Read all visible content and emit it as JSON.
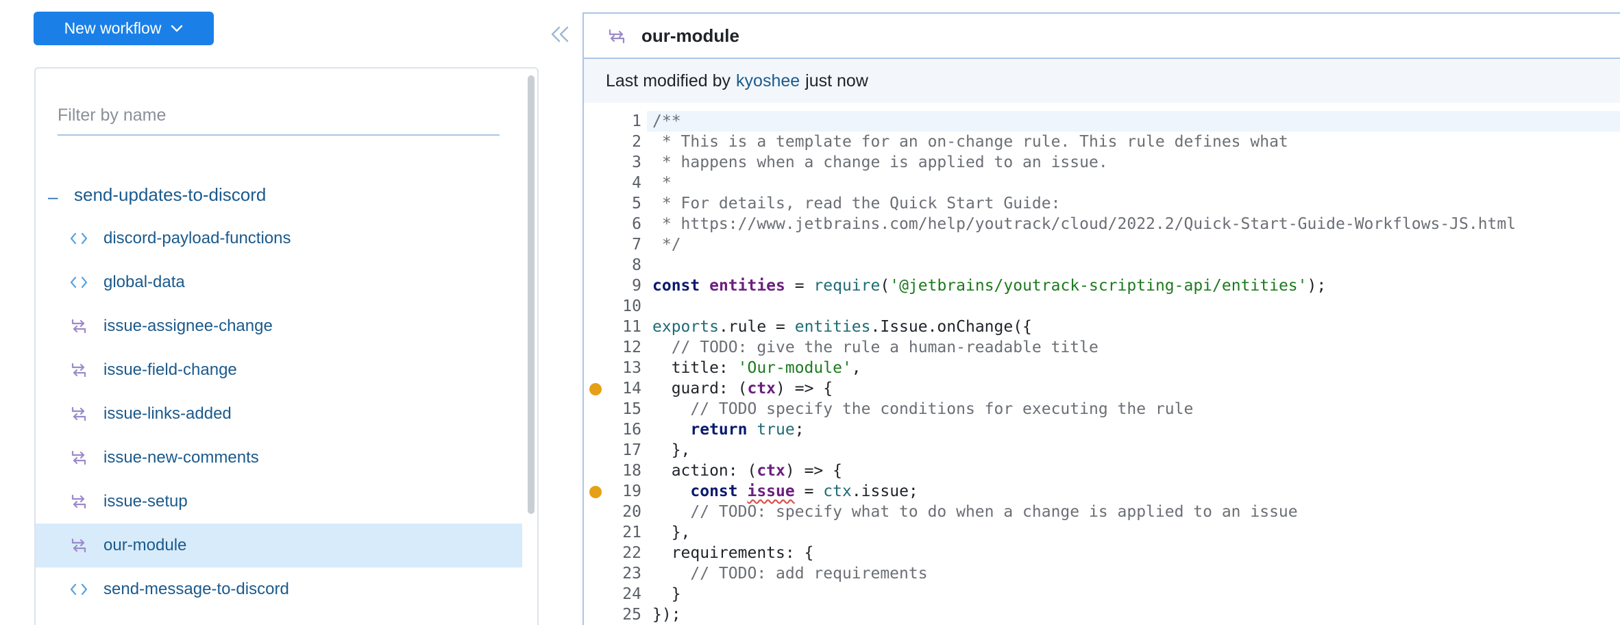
{
  "toolbar": {
    "new_workflow_label": "New workflow"
  },
  "sidebar": {
    "filter_placeholder": "Filter by name",
    "group": {
      "label": "send-updates-to-discord",
      "toggle": "–"
    },
    "items": [
      {
        "label": "discord-payload-functions",
        "icon": "code-icon"
      },
      {
        "label": "global-data",
        "icon": "code-icon"
      },
      {
        "label": "issue-assignee-change",
        "icon": "rule-arrows-icon"
      },
      {
        "label": "issue-field-change",
        "icon": "rule-arrows-icon"
      },
      {
        "label": "issue-links-added",
        "icon": "rule-arrows-icon"
      },
      {
        "label": "issue-new-comments",
        "icon": "rule-arrows-icon"
      },
      {
        "label": "issue-setup",
        "icon": "rule-arrows-icon"
      },
      {
        "label": "our-module",
        "icon": "rule-arrows-icon",
        "selected": true
      },
      {
        "label": "send-message-to-discord",
        "icon": "code-icon"
      }
    ]
  },
  "editor": {
    "title": "our-module",
    "meta": {
      "prefix": "Last modified by",
      "user": "kyoshee",
      "suffix": "just now"
    },
    "accent_colors": {
      "selected_bg": "#d7ebfa",
      "primary": "#1a80e8",
      "marker": "#e6a017"
    },
    "lines": [
      {
        "n": "1",
        "current": true,
        "parts": [
          {
            "c": "cm",
            "t": "/**"
          }
        ]
      },
      {
        "n": "2",
        "parts": [
          {
            "c": "cm",
            "t": " * This is a template for an on-change rule. This rule defines what"
          }
        ]
      },
      {
        "n": "3",
        "parts": [
          {
            "c": "cm",
            "t": " * happens when a change is applied to an issue."
          }
        ]
      },
      {
        "n": "4",
        "parts": [
          {
            "c": "cm",
            "t": " *"
          }
        ]
      },
      {
        "n": "5",
        "parts": [
          {
            "c": "cm",
            "t": " * For details, read the Quick Start Guide:"
          }
        ]
      },
      {
        "n": "6",
        "parts": [
          {
            "c": "cm",
            "t": " * https://www.jetbrains.com/help/youtrack/cloud/2022.2/Quick-Start-Guide-Workflows-JS.html"
          }
        ]
      },
      {
        "n": "7",
        "parts": [
          {
            "c": "cm",
            "t": " */"
          }
        ]
      },
      {
        "n": "8",
        "parts": []
      },
      {
        "n": "9",
        "parts": [
          {
            "c": "kw",
            "t": "const "
          },
          {
            "c": "var",
            "t": "entities"
          },
          {
            "c": "plain",
            "t": " = "
          },
          {
            "c": "fn",
            "t": "require"
          },
          {
            "c": "plain",
            "t": "("
          },
          {
            "c": "str",
            "t": "'@jetbrains/youtrack-scripting-api/entities'"
          },
          {
            "c": "plain",
            "t": ");"
          }
        ]
      },
      {
        "n": "10",
        "parts": []
      },
      {
        "n": "11",
        "parts": [
          {
            "c": "fn",
            "t": "exports"
          },
          {
            "c": "plain",
            "t": ".rule = "
          },
          {
            "c": "fn",
            "t": "entities"
          },
          {
            "c": "plain",
            "t": ".Issue.onChange({"
          }
        ]
      },
      {
        "n": "12",
        "parts": [
          {
            "c": "cm",
            "t": "  // TODO: give the rule a human-readable title"
          }
        ]
      },
      {
        "n": "13",
        "parts": [
          {
            "c": "plain",
            "t": "  title: "
          },
          {
            "c": "str",
            "t": "'Our-module'"
          },
          {
            "c": "plain",
            "t": ","
          }
        ]
      },
      {
        "n": "14",
        "marker": true,
        "parts": [
          {
            "c": "plain",
            "t": "  guard: ("
          },
          {
            "c": "var",
            "t": "ctx"
          },
          {
            "c": "plain",
            "t": ") => {"
          }
        ]
      },
      {
        "n": "15",
        "parts": [
          {
            "c": "cm",
            "t": "    // TODO specify the conditions for executing the rule"
          }
        ]
      },
      {
        "n": "16",
        "parts": [
          {
            "c": "kw",
            "t": "    return "
          },
          {
            "c": "fn",
            "t": "true"
          },
          {
            "c": "plain",
            "t": ";"
          }
        ]
      },
      {
        "n": "17",
        "parts": [
          {
            "c": "plain",
            "t": "  },"
          }
        ]
      },
      {
        "n": "18",
        "parts": [
          {
            "c": "plain",
            "t": "  action: ("
          },
          {
            "c": "var",
            "t": "ctx"
          },
          {
            "c": "plain",
            "t": ") => {"
          }
        ]
      },
      {
        "n": "19",
        "marker": true,
        "parts": [
          {
            "c": "kw",
            "t": "    const "
          },
          {
            "c": "var warn",
            "t": "issue"
          },
          {
            "c": "plain",
            "t": " = "
          },
          {
            "c": "fn",
            "t": "ctx"
          },
          {
            "c": "plain",
            "t": ".issue;"
          }
        ]
      },
      {
        "n": "20",
        "parts": [
          {
            "c": "cm",
            "t": "    // TODO: specify what to do when a change is applied to an issue"
          }
        ]
      },
      {
        "n": "21",
        "parts": [
          {
            "c": "plain",
            "t": "  },"
          }
        ]
      },
      {
        "n": "22",
        "parts": [
          {
            "c": "plain",
            "t": "  requirements: {"
          }
        ]
      },
      {
        "n": "23",
        "parts": [
          {
            "c": "cm",
            "t": "    // TODO: add requirements"
          }
        ]
      },
      {
        "n": "24",
        "parts": [
          {
            "c": "plain",
            "t": "  }"
          }
        ]
      },
      {
        "n": "25",
        "parts": [
          {
            "c": "plain",
            "t": "});"
          }
        ]
      }
    ]
  }
}
